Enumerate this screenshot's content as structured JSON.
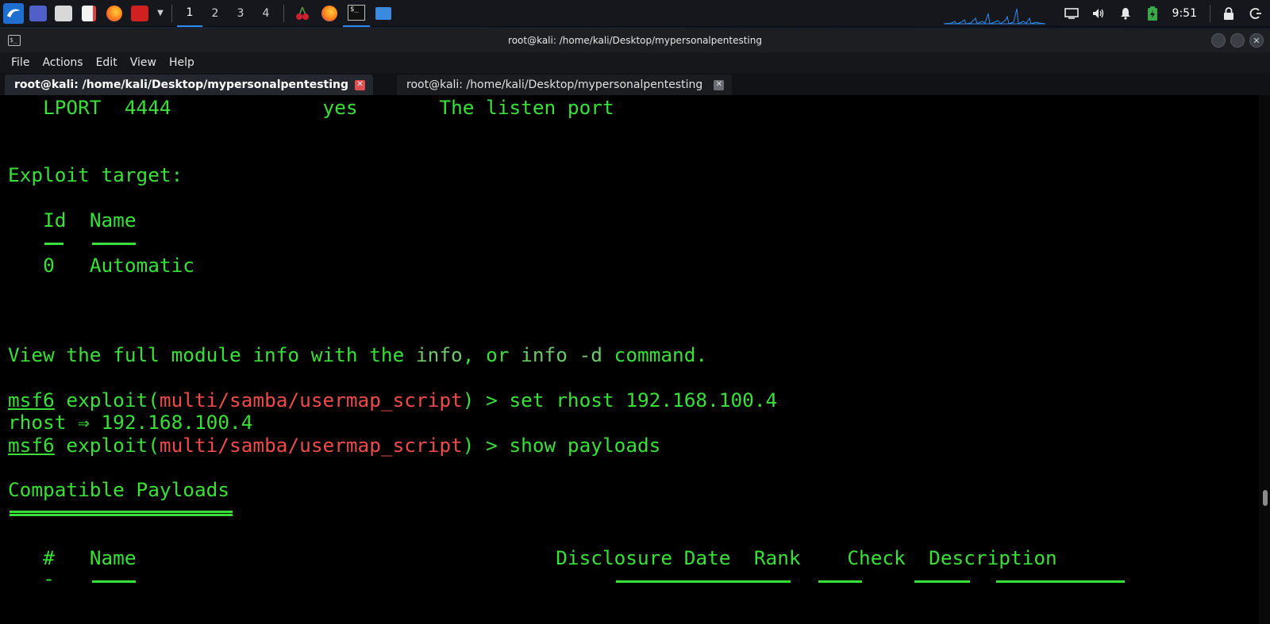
{
  "panel": {
    "workspaces": [
      "1",
      "2",
      "3",
      "4"
    ],
    "clock": "9:51",
    "colors": {
      "accent": "#2d8cf0"
    }
  },
  "window": {
    "title": "root@kali: /home/kali/Desktop/mypersonalpentesting",
    "menu": [
      "File",
      "Actions",
      "Edit",
      "View",
      "Help"
    ],
    "tabs": [
      {
        "label": "root@kali: /home/kali/Desktop/mypersonalpentesting",
        "active": true
      },
      {
        "label": "root@kali: /home/kali/Desktop/mypersonalpentesting",
        "active": false
      }
    ]
  },
  "terminal": {
    "lport_row": {
      "name": "LPORT",
      "value": "4444",
      "required": "yes",
      "desc": "The listen port"
    },
    "exploit_target_heading": "Exploit target:",
    "target_cols": {
      "id": "Id",
      "name": "Name",
      "id_rule": "--",
      "name_rule": "----"
    },
    "target_row": {
      "id": "0",
      "name": "Automatic"
    },
    "info_line": {
      "p1": "View the full module info with the ",
      "c1": "info",
      "p2": ", or ",
      "c2": "info -d",
      "p3": " command."
    },
    "prompt": {
      "msf": "msf6",
      "pre": " exploit(",
      "module": "multi/samba/usermap_script",
      "post": ") > "
    },
    "cmd1": "set rhost 192.168.100.4",
    "cmd1_out": "rhost ⇒ 192.168.100.4",
    "cmd2": "show payloads",
    "payloads_heading": "Compatible Payloads",
    "payload_cols": {
      "num": "#",
      "name": "Name",
      "date": "Disclosure Date",
      "rank": "Rank",
      "check": "Check",
      "desc": "Description",
      "num_rule": "-"
    },
    "colors": {
      "text": "#39e038",
      "module": "#ef4b4b",
      "command": "#6ec96a"
    }
  }
}
